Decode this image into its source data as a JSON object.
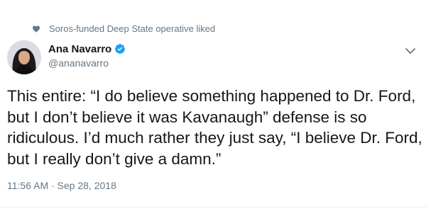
{
  "liked_by": {
    "text": "Soros-funded Deep State operative liked",
    "icon": "heart-icon"
  },
  "author": {
    "name": "Ana Navarro",
    "handle": "@ananavarro",
    "verified": true,
    "verified_color": "#1da1f2",
    "avatar": "avatar"
  },
  "menu": {
    "icon": "chevron-down-icon"
  },
  "tweet": {
    "text": "This entire: “I do believe something happened to Dr. Ford, but I don’t believe it was Kavanaugh” defense is so ridiculous. I’d much rather they just say, “I believe Dr. Ford, but I really don’t give a damn.”",
    "timestamp": "11:56 AM · Sep 28, 2018"
  }
}
